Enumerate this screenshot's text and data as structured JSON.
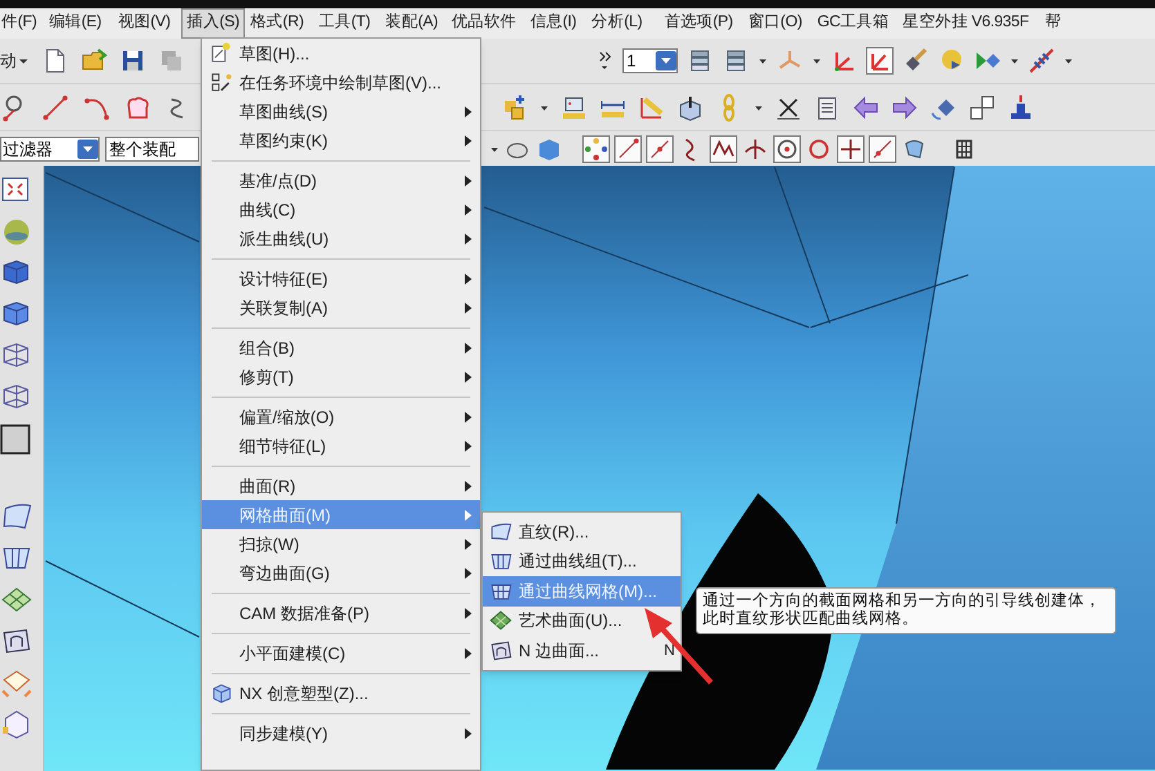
{
  "menu_bar": [
    {
      "label": "件(F)",
      "selected": false
    },
    {
      "label": "编辑(E)",
      "selected": false
    },
    {
      "label": "视图(V)",
      "selected": false
    },
    {
      "label": "插入(S)",
      "selected": true
    },
    {
      "label": "格式(R)",
      "selected": false
    },
    {
      "label": "工具(T)",
      "selected": false
    },
    {
      "label": "装配(A)",
      "selected": false
    },
    {
      "label": "优品软件",
      "selected": false
    },
    {
      "label": "信息(I)",
      "selected": false
    },
    {
      "label": "分析(L)",
      "selected": false
    },
    {
      "label": "首选项(P)",
      "selected": false
    },
    {
      "label": "窗口(O)",
      "selected": false
    },
    {
      "label": "GC工具箱",
      "selected": false
    },
    {
      "label": "星空外挂 V6.935F",
      "selected": false
    },
    {
      "label": "帮",
      "selected": false
    }
  ],
  "toolbar": {
    "start_button": "动",
    "layer_select": "1",
    "type_filter": "过滤器",
    "assembly_scope": "整个装配"
  },
  "insert_menu": {
    "items": [
      {
        "kind": "icon-item",
        "label": "草图(H)...",
        "submenu": false,
        "selected": false
      },
      {
        "kind": "icon-item",
        "label": "在任务环境中绘制草图(V)...",
        "submenu": false,
        "selected": false
      },
      {
        "kind": "item",
        "label": "草图曲线(S)",
        "submenu": true,
        "selected": false
      },
      {
        "kind": "item",
        "label": "草图约束(K)",
        "submenu": true,
        "selected": false
      },
      {
        "kind": "separator"
      },
      {
        "kind": "item",
        "label": "基准/点(D)",
        "submenu": true,
        "selected": false
      },
      {
        "kind": "item",
        "label": "曲线(C)",
        "submenu": true,
        "selected": false
      },
      {
        "kind": "item",
        "label": "派生曲线(U)",
        "submenu": true,
        "selected": false
      },
      {
        "kind": "separator"
      },
      {
        "kind": "item",
        "label": "设计特征(E)",
        "submenu": true,
        "selected": false
      },
      {
        "kind": "item",
        "label": "关联复制(A)",
        "submenu": true,
        "selected": false
      },
      {
        "kind": "separator"
      },
      {
        "kind": "item",
        "label": "组合(B)",
        "submenu": true,
        "selected": false
      },
      {
        "kind": "item",
        "label": "修剪(T)",
        "submenu": true,
        "selected": false
      },
      {
        "kind": "separator"
      },
      {
        "kind": "item",
        "label": "偏置/缩放(O)",
        "submenu": true,
        "selected": false
      },
      {
        "kind": "item",
        "label": "细节特征(L)",
        "submenu": true,
        "selected": false
      },
      {
        "kind": "separator"
      },
      {
        "kind": "item",
        "label": "曲面(R)",
        "submenu": true,
        "selected": false
      },
      {
        "kind": "item",
        "label": "网格曲面(M)",
        "submenu": true,
        "selected": true
      },
      {
        "kind": "item",
        "label": "扫掠(W)",
        "submenu": true,
        "selected": false
      },
      {
        "kind": "item",
        "label": "弯边曲面(G)",
        "submenu": true,
        "selected": false
      },
      {
        "kind": "separator"
      },
      {
        "kind": "item",
        "label": "CAM 数据准备(P)",
        "submenu": true,
        "selected": false
      },
      {
        "kind": "separator"
      },
      {
        "kind": "item",
        "label": "小平面建模(C)",
        "submenu": true,
        "selected": false
      },
      {
        "kind": "separator"
      },
      {
        "kind": "icon-item",
        "label": "NX 创意塑型(Z)...",
        "submenu": false,
        "selected": false
      },
      {
        "kind": "separator"
      },
      {
        "kind": "item",
        "label": "同步建模(Y)",
        "submenu": true,
        "selected": false
      }
    ]
  },
  "mesh_surface_submenu": {
    "items": [
      {
        "label": "直纹(R)...",
        "selected": false
      },
      {
        "label": "通过曲线组(T)...",
        "selected": false
      },
      {
        "label": "通过曲线网格(M)...",
        "selected": true
      },
      {
        "label": "艺术曲面(U)...",
        "selected": false
      },
      {
        "label": "N 边曲面...",
        "shortcut": "N",
        "selected": false
      }
    ]
  },
  "tooltip": {
    "text": "通过一个方向的截面网格和另一方向的引导线创建体，此时直纹形状匹配曲线网格。"
  }
}
